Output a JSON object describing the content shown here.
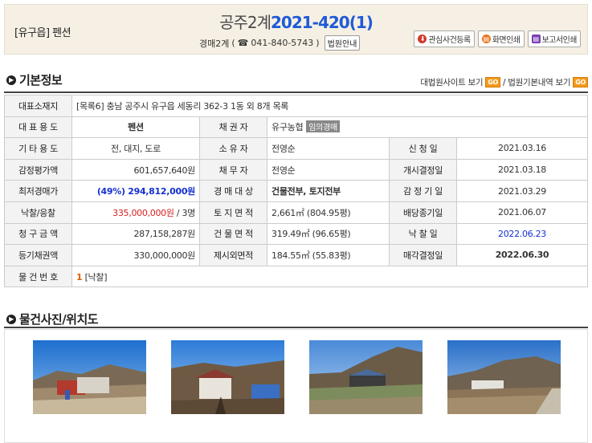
{
  "header": {
    "region": "[유구읍] 펜션",
    "court": "공주2계",
    "case_no": "2021-420(1)",
    "dept": "경매2계",
    "phone": "041-840-5743",
    "court_info_btn": "법원안내",
    "actions": [
      "관심사건등록",
      "화면인쇄",
      "보고서인쇄"
    ]
  },
  "basic": {
    "title": "기본정보",
    "link1": "대법원사이트 보기",
    "link_sep": "/",
    "link2": "법원기본내역 보기",
    "go": "GO"
  },
  "table": {
    "rep_addr_label": "대표소재지",
    "rep_addr_prefix": "[목록6]",
    "rep_addr": "충남 공주시 유구읍 세동리 362-3 1동 외 8개 목록",
    "use_label": "대 표 용 도",
    "use": "펜션",
    "creditor_label": "채 권 자",
    "creditor": "유구농협",
    "creditor_tag": "임의경매",
    "other_use_label": "기 타 용 도",
    "other_use": "전, 대지, 도로",
    "owner_label": "소 유 자",
    "owner": "전영순",
    "apply_label": "신 청 일",
    "apply_date": "2021.03.16",
    "appraisal_label": "감정평가액",
    "appraisal": "601,657,640원",
    "debtor_label": "채 무 자",
    "debtor": "전영순",
    "start_label": "개시결정일",
    "start_date": "2021.03.18",
    "min_label": "최저경매가",
    "min_pct": "(49%)",
    "min_price": "294,812,000원",
    "target_label": "경 매 대 상",
    "target": "건물전부, 토지전부",
    "appraise_date_label": "감 정 기 일",
    "appraise_date": "2021.03.29",
    "sold_label": "낙찰/응찰",
    "sold_price": "335,000,000원",
    "bidders": "/ 3명",
    "land_label": "토 지 면 적",
    "land_area": "2,661㎡ (804.95평)",
    "dividend_label": "배당종기일",
    "dividend_date": "2021.06.07",
    "claim_label": "청 구 금 액",
    "claim": "287,158,287원",
    "bldg_label": "건 물 면 적",
    "bldg_area": "319.49㎡ (96.65평)",
    "sale_label": "낙 찰 일",
    "sale_date": "2022.06.23",
    "reg_label": "등기채권액",
    "reg": "330,000,000원",
    "excl_label": "제시외면적",
    "excl_area": "184.55㎡ (55.83평)",
    "permit_label": "매각결정일",
    "permit_date": "2022.06.30",
    "item_label": "물 건 번 호",
    "item_no": "1",
    "item_status": "[낙찰]"
  },
  "photos": {
    "title": "물건사진/위치도"
  }
}
